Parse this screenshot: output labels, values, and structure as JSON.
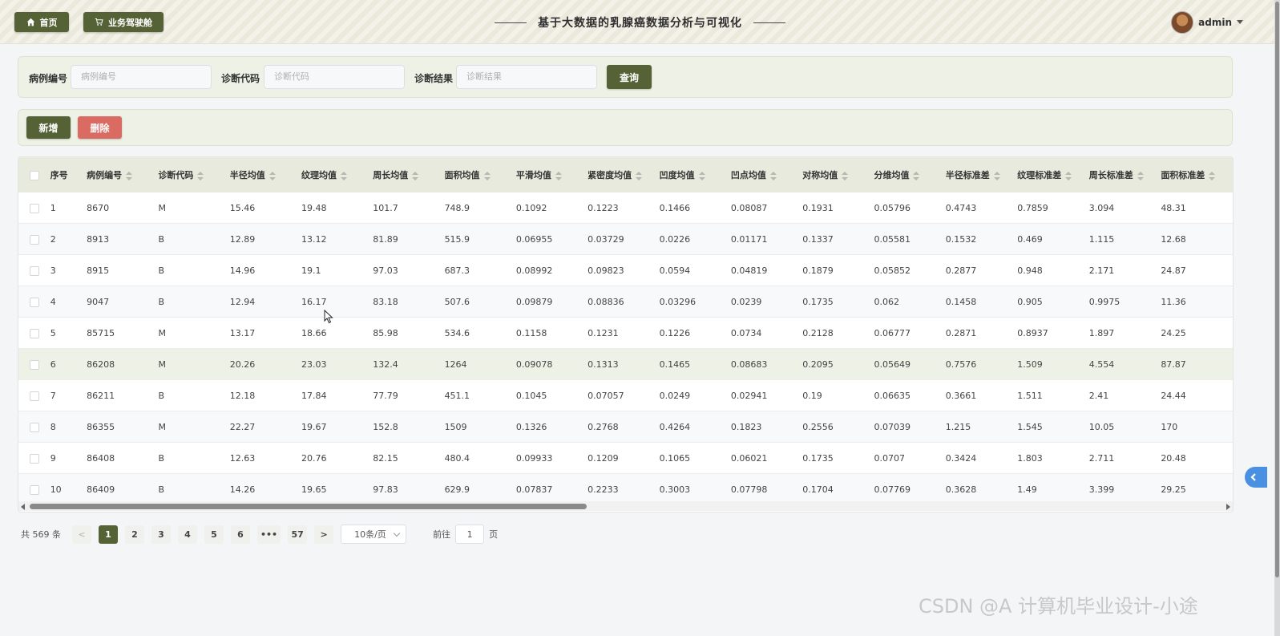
{
  "header": {
    "home_label": "首页",
    "cockpit_label": "业务驾驶舱",
    "title": "基于大数据的乳腺癌数据分析与可视化",
    "username": "admin",
    "icons": {
      "home": "home-icon",
      "cockpit": "cart-icon",
      "user_menu": "caret-down-icon"
    }
  },
  "search": {
    "fields": [
      {
        "label": "病例编号",
        "placeholder": "病例编号"
      },
      {
        "label": "诊断代码",
        "placeholder": "诊断代码"
      },
      {
        "label": "诊断结果",
        "placeholder": "诊断结果"
      }
    ],
    "query_label": "查询"
  },
  "actions": {
    "add_label": "新增",
    "delete_label": "删除"
  },
  "table": {
    "columns": [
      "序号",
      "病例编号",
      "诊断代码",
      "半径均值",
      "纹理均值",
      "周长均值",
      "面积均值",
      "平滑均值",
      "紧密度均值",
      "凹度均值",
      "凹点均值",
      "对称均值",
      "分维均值",
      "半径标准差",
      "纹理标准差",
      "周长标准差",
      "面积标准差"
    ],
    "rows": [
      [
        "1",
        "8670",
        "M",
        "15.46",
        "19.48",
        "101.7",
        "748.9",
        "0.1092",
        "0.1223",
        "0.1466",
        "0.08087",
        "0.1931",
        "0.05796",
        "0.4743",
        "0.7859",
        "3.094",
        "48.31"
      ],
      [
        "2",
        "8913",
        "B",
        "12.89",
        "13.12",
        "81.89",
        "515.9",
        "0.06955",
        "0.03729",
        "0.0226",
        "0.01171",
        "0.1337",
        "0.05581",
        "0.1532",
        "0.469",
        "1.115",
        "12.68"
      ],
      [
        "3",
        "8915",
        "B",
        "14.96",
        "19.1",
        "97.03",
        "687.3",
        "0.08992",
        "0.09823",
        "0.0594",
        "0.04819",
        "0.1879",
        "0.05852",
        "0.2877",
        "0.948",
        "2.171",
        "24.87"
      ],
      [
        "4",
        "9047",
        "B",
        "12.94",
        "16.17",
        "83.18",
        "507.6",
        "0.09879",
        "0.08836",
        "0.03296",
        "0.0239",
        "0.1735",
        "0.062",
        "0.1458",
        "0.905",
        "0.9975",
        "11.36"
      ],
      [
        "5",
        "85715",
        "M",
        "13.17",
        "18.66",
        "85.98",
        "534.6",
        "0.1158",
        "0.1231",
        "0.1226",
        "0.0734",
        "0.2128",
        "0.06777",
        "0.2871",
        "0.8937",
        "1.897",
        "24.25"
      ],
      [
        "6",
        "86208",
        "M",
        "20.26",
        "23.03",
        "132.4",
        "1264",
        "0.09078",
        "0.1313",
        "0.1465",
        "0.08683",
        "0.2095",
        "0.05649",
        "0.7576",
        "1.509",
        "4.554",
        "87.87"
      ],
      [
        "7",
        "86211",
        "B",
        "12.18",
        "17.84",
        "77.79",
        "451.1",
        "0.1045",
        "0.07057",
        "0.0249",
        "0.02941",
        "0.19",
        "0.06635",
        "0.3661",
        "1.511",
        "2.41",
        "24.44"
      ],
      [
        "8",
        "86355",
        "M",
        "22.27",
        "19.67",
        "152.8",
        "1509",
        "0.1326",
        "0.2768",
        "0.4264",
        "0.1823",
        "0.2556",
        "0.07039",
        "1.215",
        "1.545",
        "10.05",
        "170"
      ],
      [
        "9",
        "86408",
        "B",
        "12.63",
        "20.76",
        "82.15",
        "480.4",
        "0.09933",
        "0.1209",
        "0.1065",
        "0.06021",
        "0.1735",
        "0.0707",
        "0.3424",
        "1.803",
        "2.711",
        "20.48"
      ],
      [
        "10",
        "86409",
        "B",
        "14.26",
        "19.65",
        "97.83",
        "629.9",
        "0.07837",
        "0.2233",
        "0.3003",
        "0.07798",
        "0.1704",
        "0.07769",
        "0.3628",
        "1.49",
        "3.399",
        "29.25"
      ]
    ]
  },
  "pagination": {
    "total_text": "共 569 条",
    "pages": [
      "1",
      "2",
      "3",
      "4",
      "5",
      "6",
      "•••",
      "57"
    ],
    "current": "1",
    "page_size": "10条/页",
    "goto_label": "前往",
    "goto_value": "1",
    "page_suffix": "页"
  },
  "watermark": "CSDN @A 计算机毕业设计-小途",
  "colors": {
    "primary": "#556236",
    "danger": "#d96b63",
    "panel": "#eef1e6",
    "table_header": "#e7eadd"
  }
}
